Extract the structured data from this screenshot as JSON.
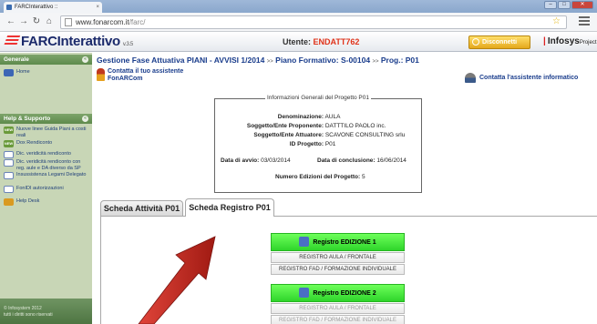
{
  "browser": {
    "tab_title": "FARCInterattivo ::",
    "tab_close": "×",
    "url_host": "www.fonarcom.it",
    "url_path": "/farc/",
    "win_min": "–",
    "win_max": "□",
    "win_close": "✕"
  },
  "header": {
    "logo_text": "FARCInterattivo",
    "logo_version": "v.3.5",
    "utente_label": "Utente:",
    "utente_value": "ENDATT762",
    "disconnetti_label": "Disconnetti",
    "infosys_label": "Infosys",
    "infosys_sub": "Project"
  },
  "sidebar": {
    "section1_title": "Generale",
    "home_label": "Home",
    "section2_title": "Help & Supporto",
    "items": [
      {
        "label": "Nuove linee Guida Piani a costi reali",
        "icon": "NEW"
      },
      {
        "label": "Dox Rendiconto",
        "icon": "NEW"
      },
      {
        "label": "Dic. veridicità rendiconto",
        "icon": "doc"
      },
      {
        "label": "Dic. veridicità rendiconto con reg. aule e DA diverso da SP",
        "icon": "doc"
      },
      {
        "label": "Insussistenza Legami Delegato",
        "icon": "doc"
      },
      {
        "label": "FonIDI autorizzazioni",
        "icon": "doc"
      },
      {
        "label": "Help Desk",
        "icon": "help"
      }
    ],
    "footer_line1": "© Infosystem 2012",
    "footer_line2": "tutti i diritti sono riservati"
  },
  "main": {
    "breadcrumb_part1": "Gestione Fase Attuativa PIANI - AVVISI 1/2014",
    "breadcrumb_sep": ">>",
    "breadcrumb_part2": "Piano Formativo: S-00104",
    "breadcrumb_part3": "Prog.: P01",
    "contact_assistant_line1": "Contatta il tuo assistente",
    "contact_assistant_line2": "FonARCom",
    "contact_it": "Contatta l'assistente informatico",
    "info_title": "Informazioni Generali del Progetto P01",
    "info": {
      "denominazione_label": "Denominazione:",
      "denominazione_value": "AULA",
      "proponente_label": "Soggetto/Ente Proponente:",
      "proponente_value": "DATTTILO PAOLO inc.",
      "attuatore_label": "Soggetto/Ente Attuatore:",
      "attuatore_value": "SCAVONE CONSULTING srlu",
      "id_label": "ID Progetto:",
      "id_value": "P01",
      "avvio_label": "Data di avvio:",
      "avvio_value": "03/03/2014",
      "conclusione_label": "Data di conclusione:",
      "conclusione_value": "16/06/2014",
      "edizioni_label": "Numero Edizioni del Progetto:",
      "edizioni_value": "5"
    },
    "tabs": [
      {
        "label": "Scheda Attività P01",
        "active": false
      },
      {
        "label": "Scheda Registro P01",
        "active": true
      }
    ],
    "registri": [
      {
        "title": "Registro EDIZIONE 1",
        "btn1": "REGISTRO AULA / FRONTALE",
        "btn2": "REGISTRO FAD / FORMAZIONE INDIVIDUALE"
      },
      {
        "title": "Registro EDIZIONE 2",
        "btn1": "REGISTRO AULA / FRONTALE",
        "btn2": "REGISTRO FAD / FORMAZIONE INDIVIDUALE"
      }
    ]
  },
  "colors": {
    "accent_red": "#e0331a",
    "link_blue": "#1a3d8c",
    "sidebar_green": "#5e8a4c",
    "registro_green": "#2fd52b",
    "arrow_red": "#c4281d"
  }
}
